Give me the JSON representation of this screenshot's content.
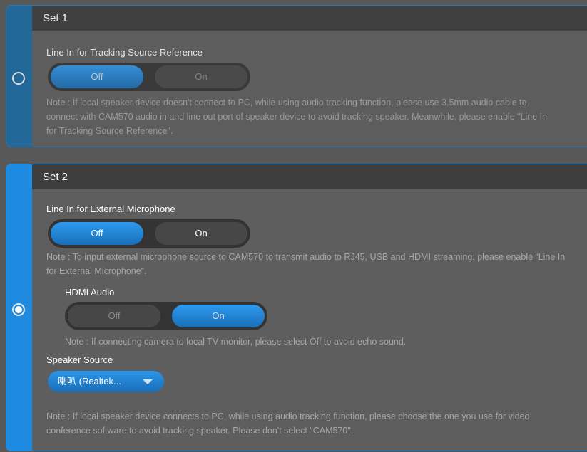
{
  "set1": {
    "title": "Set 1",
    "selected": false,
    "line_in_tracking": {
      "label": "Line In for Tracking Source Reference",
      "off_label": "Off",
      "on_label": "On",
      "value": "Off"
    },
    "note": "Note : If local speaker device doesn't connect to PC, while using audio tracking function, please use 3.5mm audio cable to connect with CAM570 audio in and line out port of speaker device to avoid tracking speaker. Meanwhile, please enable \"Line In for Tracking Source Reference\"."
  },
  "set2": {
    "title": "Set 2",
    "selected": true,
    "line_in_mic": {
      "label": "Line In for External Microphone",
      "off_label": "Off",
      "on_label": "On",
      "value": "Off"
    },
    "mic_note": "Note : To input external microphone source to CAM570 to transmit audio to RJ45, USB and HDMI streaming, please enable “Line In for External Microphone”.",
    "hdmi_audio": {
      "label": "HDMI Audio",
      "off_label": "Off",
      "on_label": "On",
      "value": "On"
    },
    "hdmi_note": "Note : If connecting camera to local TV monitor, please select Off to avoid echo sound.",
    "speaker_source": {
      "label": "Speaker Source",
      "selected": "喇叭 (Realtek..."
    },
    "speaker_note": "Note : If local speaker device connects to PC, while using audio tracking function, please choose the one you use for video conference software to avoid tracking speaker. Please don't select \"CAM570\"."
  },
  "colors": {
    "accent": "#1e8be0",
    "header_bg": "#3e3e3e",
    "panel_bg": "#5e5e5e"
  }
}
